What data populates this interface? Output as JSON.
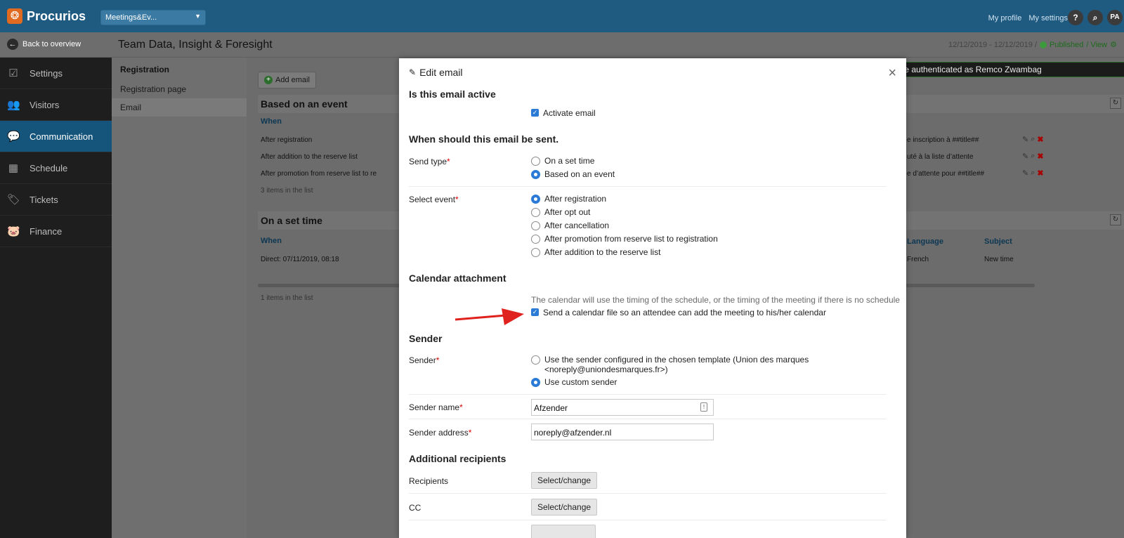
{
  "app": {
    "brand": "Procurios",
    "module": "Meetings&Ev...",
    "top_links": [
      "My profile",
      "My settings"
    ],
    "help_label": "?",
    "user_initials": "PA"
  },
  "subbar": {
    "back_label": "Back to overview",
    "event_title": "Team Data, Insight & Foresight",
    "dates": "12/12/2019 - 12/12/2019 /",
    "status": "Published",
    "view_link": "/ View"
  },
  "sidebar": {
    "items": [
      {
        "label": "Settings",
        "icon": "☑"
      },
      {
        "label": "Visitors",
        "icon": "👥"
      },
      {
        "label": "Communication",
        "icon": "💬"
      },
      {
        "label": "Schedule",
        "icon": "▦"
      },
      {
        "label": "Tickets",
        "icon": "🏷"
      },
      {
        "label": "Finance",
        "icon": "🐷"
      }
    ]
  },
  "subnav": {
    "heading": "Registration",
    "items": [
      "Registration page",
      "Email"
    ]
  },
  "background": {
    "add_email": "Add email",
    "banner": "ou are authenticated as Remco Zwambag",
    "section1": {
      "title": "Based on an event",
      "col_when": "When",
      "rows": [
        {
          "when": "After registration",
          "subject": "e inscription à ##title##"
        },
        {
          "when": "After addition to the reserve list",
          "subject": "uté à la liste d’attente"
        },
        {
          "when": "After promotion from reserve list to re",
          "subject": "e d’attente pour ##title##"
        }
      ],
      "count": "3 items in the list"
    },
    "section2": {
      "title": "On a set time",
      "col_when": "When",
      "col_language": "Language",
      "col_subject": "Subject",
      "row": {
        "when": "Direct: 07/11/2019, 08:18",
        "language": "French",
        "subject": "New time"
      },
      "count": "1 items in the list"
    }
  },
  "modal": {
    "title": "Edit email",
    "active_heading": "Is this email active",
    "activate_label": "Activate email",
    "when_heading": "When should this email be sent.",
    "send_type_label": "Send type",
    "send_type_options": [
      "On a set time",
      "Based on an event"
    ],
    "send_type_selected": "Based on an event",
    "event_label": "Select event",
    "event_options": [
      "After registration",
      "After opt out",
      "After cancellation",
      "After promotion from reserve list to registration",
      "After addition to the reserve list"
    ],
    "event_selected": "After registration",
    "calendar_heading": "Calendar attachment",
    "calendar_note": "The calendar will use the timing of the schedule, or the timing of the meeting if there is no schedule",
    "calendar_checkbox": "Send a calendar file so an attendee can add the meeting to his/her calendar",
    "sender_heading": "Sender",
    "sender_label": "Sender",
    "sender_option1_line1": "Use the sender configured in the chosen template (Union des marques",
    "sender_option1_line2": "<noreply@uniondesmarques.fr>)",
    "sender_option2": "Use custom sender",
    "sender_name_label": "Sender name",
    "sender_name_value": "Afzender",
    "sender_address_label": "Sender address",
    "sender_address_value": "noreply@afzender.nl",
    "recipients_heading": "Additional recipients",
    "recipients_label": "Recipients",
    "cc_label": "CC",
    "select_change": "Select/change",
    "required_mark": "*"
  }
}
